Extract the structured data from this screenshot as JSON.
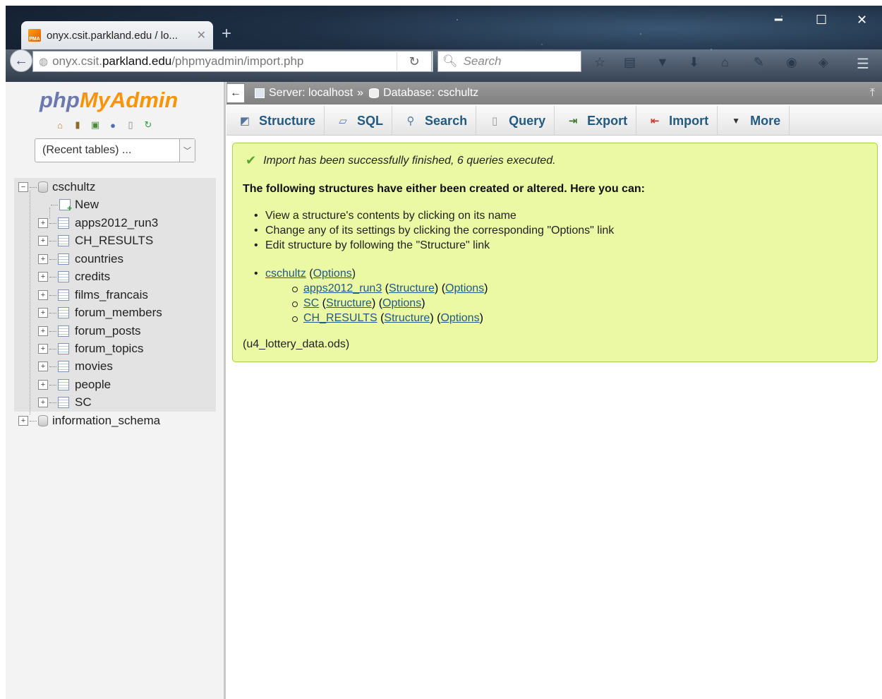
{
  "browser": {
    "tab_title": "onyx.csit.parkland.edu / lo...",
    "favicon_text": "PMA",
    "url_prefix": "onyx.csit.",
    "url_domain": "parkland.edu",
    "url_path": "/phpmyadmin/import.php",
    "search_placeholder": "Search"
  },
  "sidebar": {
    "logo_php": "php",
    "logo_my": "My",
    "logo_admin": "Admin",
    "recent_tables": "(Recent tables) ...",
    "tree": {
      "db": "cschultz",
      "new": "New",
      "tables": [
        "apps2012_run3",
        "CH_RESULTS",
        "countries",
        "credits",
        "films_francais",
        "forum_members",
        "forum_posts",
        "forum_topics",
        "movies",
        "people",
        "SC"
      ],
      "other_db": "information_schema"
    }
  },
  "breadcrumb": {
    "server": "Server: localhost",
    "sep": "»",
    "database": "Database: cschultz"
  },
  "tabs": [
    "Structure",
    "SQL",
    "Search",
    "Query",
    "Export",
    "Import",
    "More"
  ],
  "notice": {
    "success": "Import has been successfully finished, 6 queries executed.",
    "heading": "The following structures have either been created or altered. Here you can:",
    "hints": [
      "View a structure's contents by clicking on its name",
      "Change any of its settings by clicking the corresponding \"Options\" link",
      "Edit structure by following the \"Structure\" link"
    ],
    "db_link": "cschultz",
    "options": "Options",
    "structure": "Structure",
    "altered_tables": [
      "apps2012_run3",
      "SC",
      "CH_RESULTS"
    ],
    "filename": "(u4_lottery_data.ods)"
  }
}
